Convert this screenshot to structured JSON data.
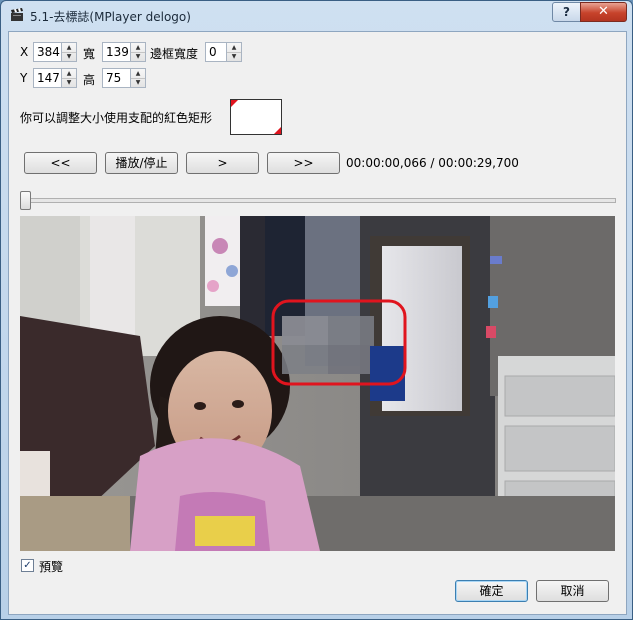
{
  "window": {
    "title": "5.1-去標誌(MPlayer delogo)",
    "help_label": "?",
    "close_label": "✕"
  },
  "fields": {
    "x_label": "X",
    "x_value": "384",
    "w_label": "寬",
    "w_value": "139",
    "border_label": "邊框寬度",
    "border_value": "0",
    "y_label": "Y",
    "y_value": "147",
    "h_label": "高",
    "h_value": "75"
  },
  "hint": "你可以調整大小使用支配的紅色矩形",
  "controls": {
    "rewind_label": "<<",
    "play_label": "播放/停止",
    "step_label": ">",
    "forward_label": ">>",
    "time": "00:00:00,066 / 00:00:29,700"
  },
  "preview": {
    "label": "預覽",
    "checked": true
  },
  "footer": {
    "ok_label": "確定",
    "cancel_label": "取消"
  },
  "colors": {
    "accent_red": "#e0141e",
    "title_bg": "#c5d9ee",
    "close_red": "#c7432b"
  }
}
